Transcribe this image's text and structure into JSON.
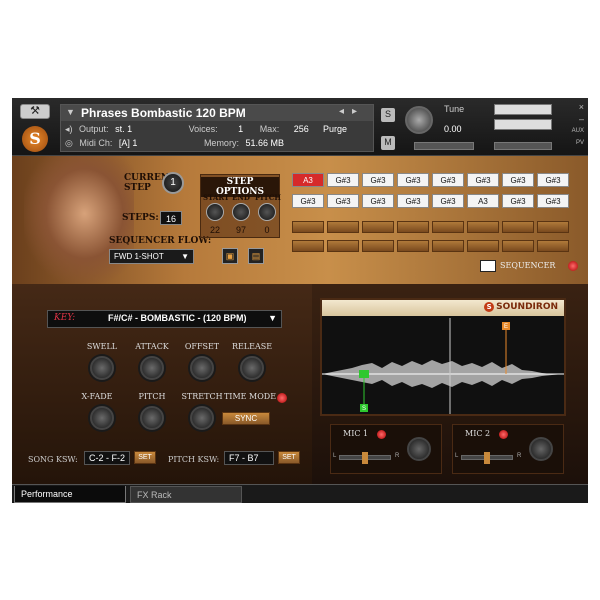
{
  "header": {
    "instrument_name": "Phrases Bombastic 120 BPM",
    "output_label": "Output:",
    "output_value": "st. 1",
    "voices_label": "Voices:",
    "voices_value": "1",
    "max_label": "Max:",
    "max_value": "256",
    "purge_label": "Purge",
    "midi_label": "Midi Ch:",
    "midi_value": "[A] 1",
    "memory_label": "Memory:",
    "memory_value": "51.66 MB",
    "solo_label": "S",
    "mute_label": "M",
    "tune_label": "Tune",
    "tune_value": "0.00",
    "aux_label": "AUX",
    "pv_label": "PV",
    "close_glyph": "×",
    "minimize_glyph": "–"
  },
  "sequencer": {
    "current_step_label": "CURRENT STEP",
    "current_step_value": "1",
    "steps_label": "STEPS:",
    "steps_value": "16",
    "flow_label": "SEQUENCER FLOW:",
    "flow_value": "FWD 1-SHOT",
    "step_options_title": "STEP OPTIONS",
    "start_label": "START",
    "end_label": "END",
    "pitch_label": "PITCH",
    "start_value": "22",
    "end_value": "97",
    "pitch_value": "0",
    "row1": [
      "A3",
      "G#3",
      "G#3",
      "G#3",
      "G#3",
      "G#3",
      "G#3",
      "G#3"
    ],
    "row2": [
      "G#3",
      "G#3",
      "G#3",
      "G#3",
      "G#3",
      "A3",
      "G#3",
      "G#3"
    ],
    "active_cell": "A3",
    "sequencer_label": "SEQUENCER"
  },
  "controls": {
    "key_label": "KEY:",
    "key_value": "F#/C# - BOMBASTIC - (120 BPM)",
    "swell_label": "SWELL",
    "attack_label": "ATTACK",
    "offset_label": "OFFSET",
    "release_label": "RELEASE",
    "xfade_label": "X-FADE",
    "pitch_label": "PITCH",
    "stretch_label": "STRETCH",
    "time_mode_label": "TIME MODE",
    "sync_label": "SYNC",
    "song_ksw_label": "SONG KSW:",
    "song_ksw_value": "C-2 - F-2",
    "pitch_ksw_label": "PITCH KSW:",
    "pitch_ksw_value": "F7 - B7",
    "set_label": "SET"
  },
  "waveform": {
    "brand": "SOUNDIRON",
    "start_marker": "S",
    "end_marker": "E"
  },
  "mics": {
    "mic1_label": "MIC 1",
    "mic2_label": "MIC 2",
    "left": "L",
    "right": "R"
  },
  "tabs": {
    "performance": "Performance",
    "fx_rack": "FX Rack"
  },
  "colors": {
    "accent_red": "#d62a2a",
    "brand_orange": "#c23a14"
  }
}
